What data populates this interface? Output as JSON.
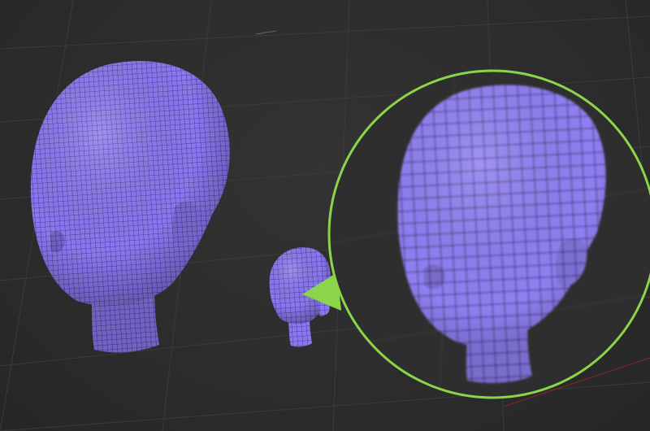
{
  "viewport": {
    "background_color": "#2b2b2b",
    "grid_line_color": "#3d3d3d",
    "axis_color": "#8a2a2a"
  },
  "models": [
    {
      "name": "large-head-mesh",
      "color": "#8a78f0",
      "wire_color": "#3a2f6e",
      "detail": "dense"
    },
    {
      "name": "small-head-mesh",
      "color": "#8a78f0",
      "wire_color": "#3a2f6e",
      "detail": "dense"
    },
    {
      "name": "magnified-head-mesh",
      "color": "#8a78f0",
      "wire_color": "#3a2f6e",
      "detail": "coarse"
    }
  ],
  "magnifier": {
    "ring_color": "#8cd44a",
    "pointer_color": "#8cd44a"
  }
}
